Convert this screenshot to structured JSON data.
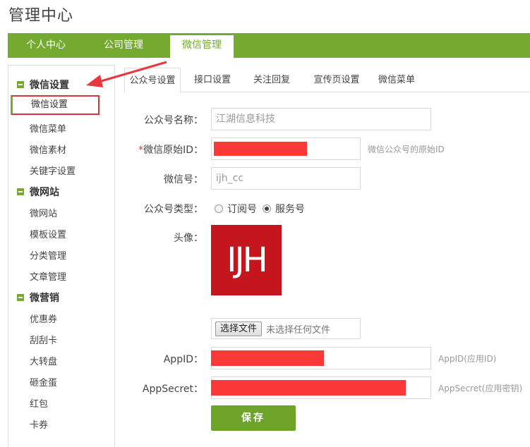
{
  "page_title": "管理中心",
  "topnav": {
    "tabs": [
      {
        "label": "个人中心"
      },
      {
        "label": "公司管理"
      },
      {
        "label": "微信管理"
      }
    ]
  },
  "sidebar": {
    "groups": [
      {
        "label": "微信设置",
        "items": [
          "微信设置",
          "微信菜单",
          "微信素材",
          "关键字设置"
        ]
      },
      {
        "label": "微网站",
        "items": [
          "微网站",
          "模板设置",
          "分类管理",
          "文章管理"
        ]
      },
      {
        "label": "微营销",
        "items": [
          "优惠券",
          "刮刮卡",
          "大转盘",
          "砸金蛋",
          "红包",
          "卡券"
        ]
      }
    ]
  },
  "subtabs": [
    "公众号设置",
    "接口设置",
    "关注回复",
    "宣传页设置",
    "微信菜单"
  ],
  "form": {
    "account_name_label": "公众号名称：",
    "account_name_value": "江湖信息科技",
    "original_id_req": "*",
    "original_id_label": "微信原始ID：",
    "original_id_hint": "微信公众号的原始ID",
    "wechat_id_label": "微信号：",
    "wechat_id_value": "ijh_cc",
    "type_label": "公众号类型：",
    "type_options": [
      "订阅号",
      "服务号"
    ],
    "avatar_label": "头像：",
    "avatar_text": "IJH",
    "file_button": "选择文件",
    "file_status": "未选择任何文件",
    "appid_label": "AppID：",
    "appid_hint": "AppID(应用ID)",
    "appsecret_label": "AppSecret：",
    "appsecret_hint": "AppSecret(应用密钥)",
    "save_label": "保存"
  },
  "colors": {
    "brand_green": "#74aa2f",
    "annotation_red": "#d9343a",
    "redaction": "#fb3838",
    "logo_bg": "#c4161c"
  }
}
